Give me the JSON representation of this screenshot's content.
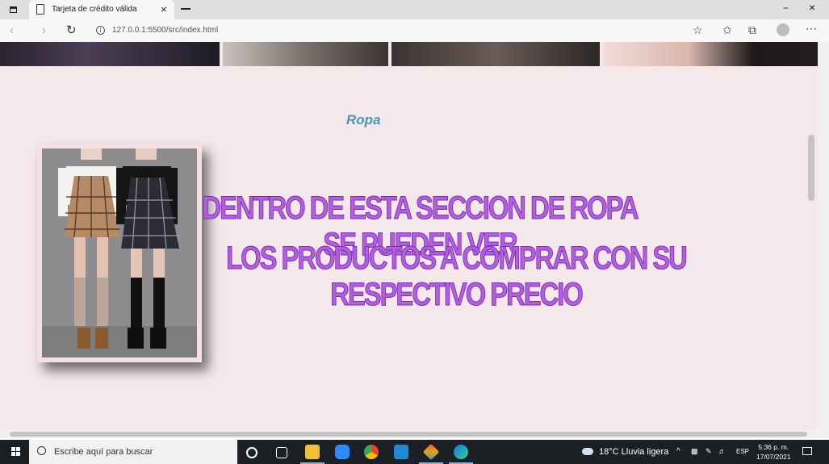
{
  "browser": {
    "tab_title": "Tarjeta de crédito válida",
    "tab_close": "×",
    "url": "127.0.0.1:5500/src/index.html",
    "minimize": "−",
    "close": "×"
  },
  "page": {
    "section_title": "Ropa",
    "headline_line1": "DENTRO DE ESTA SECCION DE ROPA SE PUEDEN VER",
    "headline_line2": "LOS PRODUCTOS A COMPRAR CON SU RESPECTIVO PRECIO",
    "background_color": "#f5e8eb",
    "headline_color": "#b15ee0",
    "title_color": "#4d95b3"
  },
  "taskbar": {
    "search_placeholder": "Escribe aquí para buscar",
    "weather": "18°C  Lluvia ligera",
    "language": "ESP",
    "time": "5:36 p. m.",
    "date": "17/07/2021"
  }
}
